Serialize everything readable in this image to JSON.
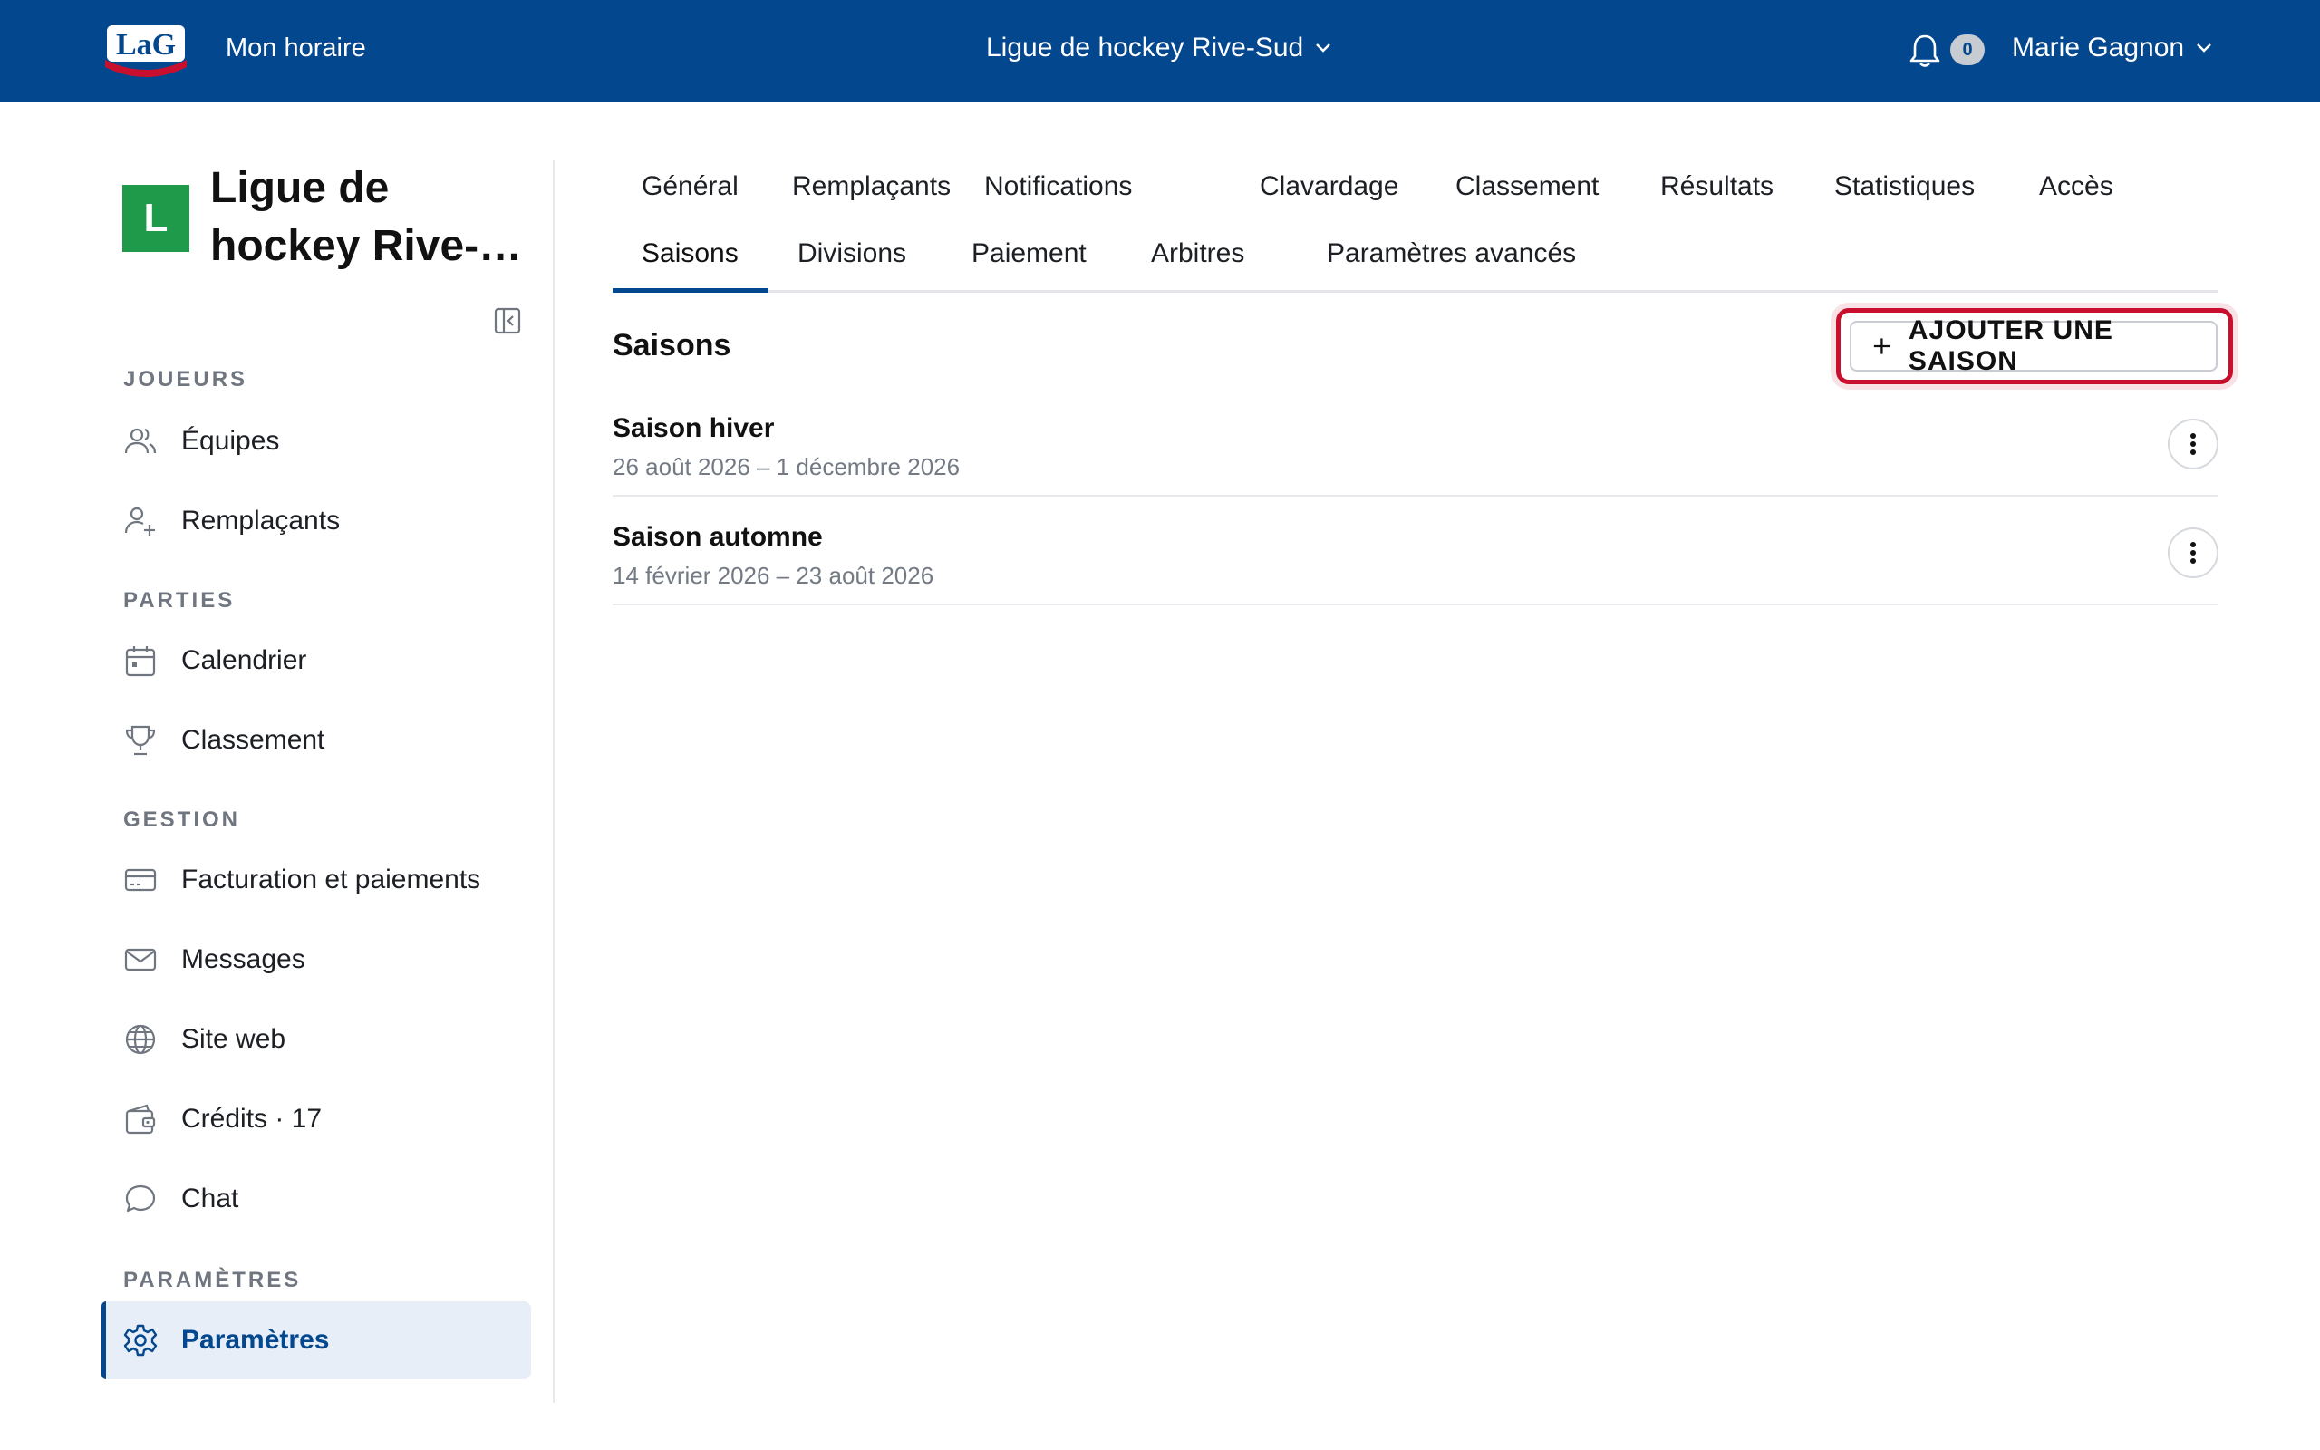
{
  "header": {
    "logo_text": "LaG",
    "my_schedule": "Mon horaire",
    "league_name": "Ligue de hockey Rive-Sud",
    "notifications_count": "0",
    "user_name": "Marie Gagnon"
  },
  "sidebar": {
    "league_initial": "L",
    "league_title": "Ligue de hockey Rive-…",
    "sections": {
      "players": "JOUEURS",
      "games": "PARTIES",
      "management": "GESTION",
      "settings": "PARAMÈTRES"
    },
    "items": {
      "teams": "Équipes",
      "substitutes": "Remplaçants",
      "calendar": "Calendrier",
      "standings": "Classement",
      "billing": "Facturation et paiements",
      "messages": "Messages",
      "website": "Site web",
      "credits": "Crédits · 17",
      "chat": "Chat",
      "settings": "Paramètres"
    }
  },
  "tabs": [
    {
      "label": "Général"
    },
    {
      "label": "Remplaçants"
    },
    {
      "label": "Notifications"
    },
    {
      "label": "Clavardage"
    },
    {
      "label": "Classement"
    },
    {
      "label": "Résultats"
    },
    {
      "label": "Statistiques"
    },
    {
      "label": "Accès"
    },
    {
      "label": "Saisons",
      "active": true
    },
    {
      "label": "Divisions"
    },
    {
      "label": "Paiement"
    },
    {
      "label": "Arbitres"
    },
    {
      "label": "Paramètres avancés"
    }
  ],
  "main": {
    "title": "Saisons",
    "add_button_label": "AJOUTER UNE SAISON",
    "seasons": [
      {
        "name": "Saison hiver",
        "dates": "26 août 2026 – 1 décembre 2026"
      },
      {
        "name": "Saison automne",
        "dates": "14 février 2026 – 23 août 2026"
      }
    ]
  },
  "colors": {
    "brand_blue": "#03478f",
    "league_avatar": "#1f9a4a",
    "focus_red": "#c8102e"
  }
}
